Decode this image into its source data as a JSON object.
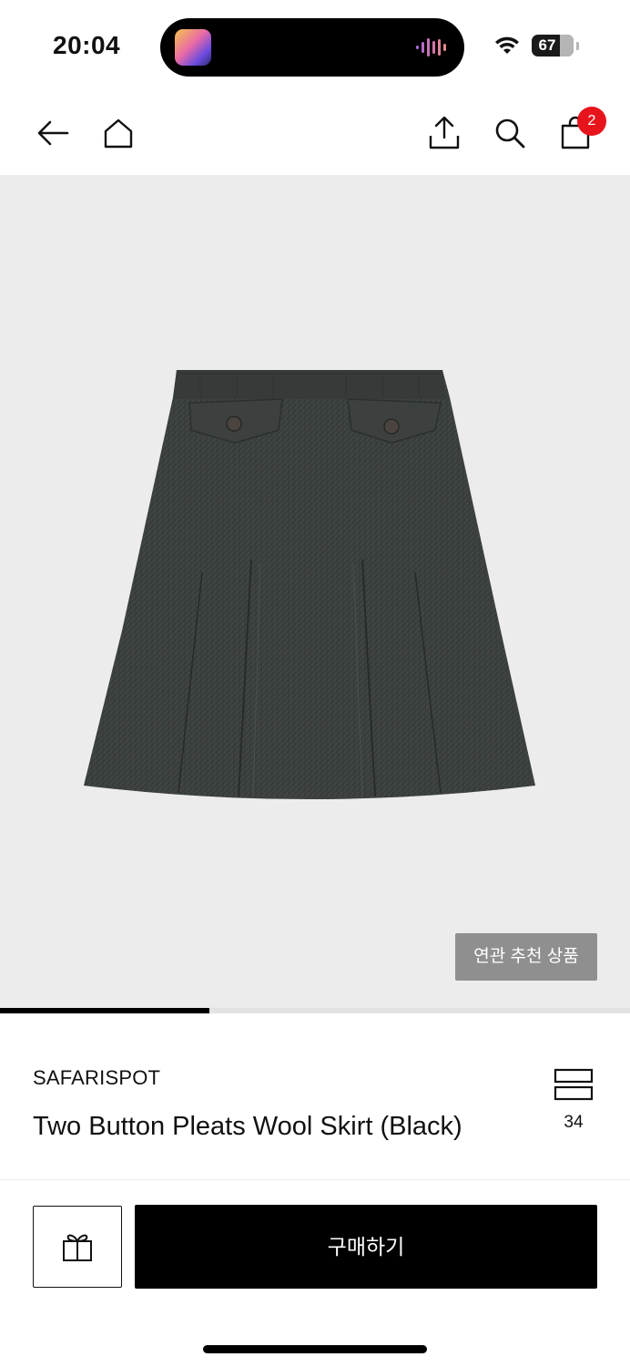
{
  "status_bar": {
    "time": "20:04",
    "battery": "67",
    "battery_level_percent": 67,
    "icons": [
      "app-activity-icon",
      "audio-wave-icon",
      "wifi-icon",
      "battery-icon"
    ]
  },
  "nav": {
    "icons": [
      "back-arrow-icon",
      "home-icon",
      "share-icon",
      "search-icon",
      "shopping-bag-icon"
    ],
    "cart_count": "2"
  },
  "product_image": {
    "related_button_label": "연관 추천 상품",
    "gallery_progress_fraction": 0.333
  },
  "product": {
    "brand": "SAFARISPOT",
    "name": "Two Button Pleats Wool Skirt (Black)",
    "like_count": "34"
  },
  "bottom_bar": {
    "gift_icon": "gift-icon",
    "buy_label": "구매하기"
  },
  "colors": {
    "badge": "#e8141c",
    "buy_button": "#000000",
    "related_button": "#8f8f8f",
    "image_background": "#ececec"
  }
}
